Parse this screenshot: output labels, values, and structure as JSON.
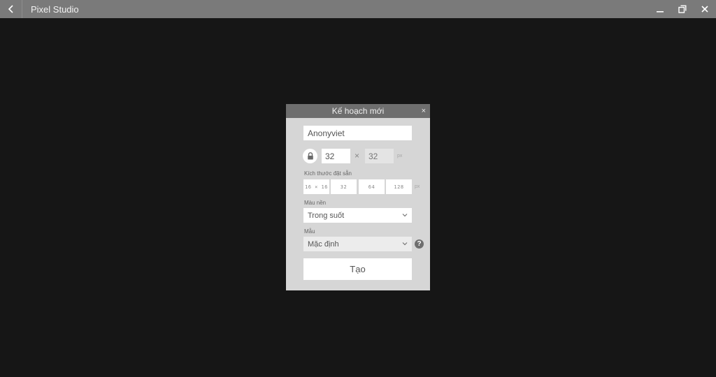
{
  "window": {
    "title": "Pixel Studio",
    "icons": {
      "back": "chevron-left-icon",
      "minimize": "minimize-icon",
      "restore": "restore-icon",
      "close": "close-icon"
    }
  },
  "dialog": {
    "title": "Kế hoạch mới",
    "close_label": "×",
    "name_value": "Anonyviet",
    "width_value": "32",
    "height_value": "32",
    "times_symbol": "×",
    "unit": "px",
    "preset_label": "Kích thước đặt sẵn",
    "presets": [
      "16 × 16",
      "32",
      "64",
      "128"
    ],
    "preset_unit": "px",
    "background_label": "Màu nền",
    "background_value": "Trong suốt",
    "template_label": "Mẫu",
    "template_value": "Mặc định",
    "help_label": "?",
    "create_label": "Tạo"
  },
  "colors": {
    "titlebar": "#7a7a7a",
    "canvas": "#161616",
    "dialog_header": "#6e6e6e",
    "dialog_body": "#d6d6d6"
  }
}
